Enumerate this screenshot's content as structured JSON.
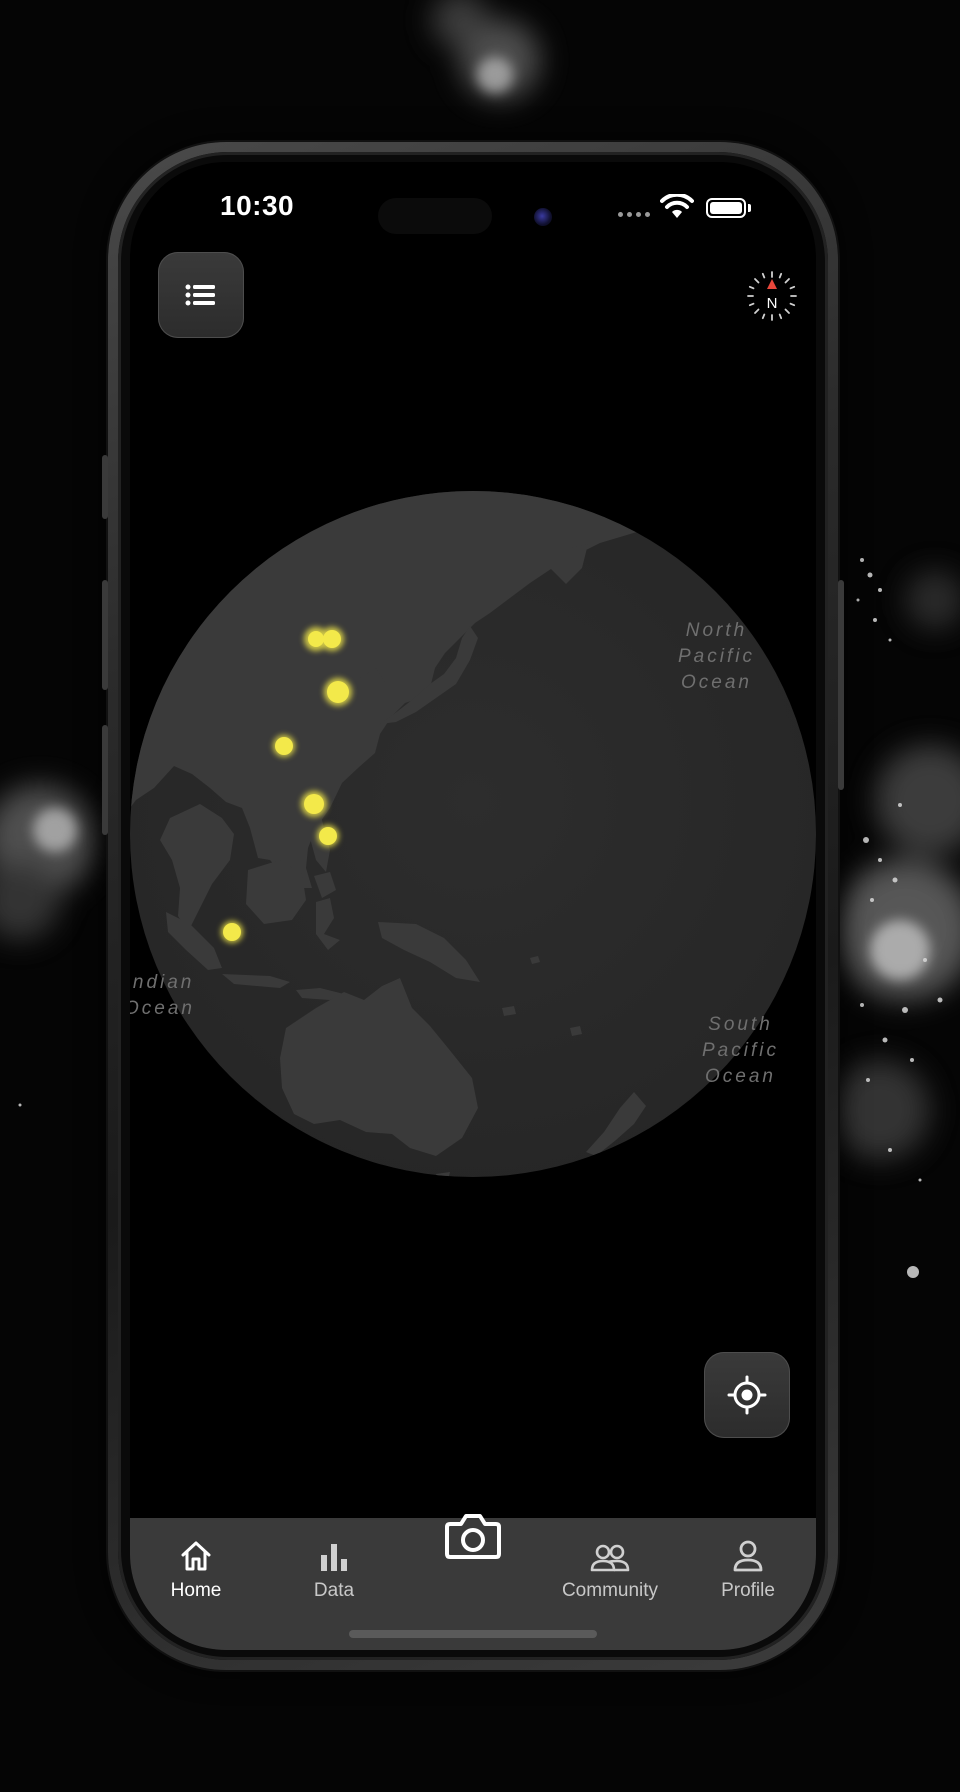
{
  "status_bar": {
    "time": "10:30"
  },
  "map": {
    "ocean_labels": {
      "north_pacific": [
        "North",
        "Pacific",
        "Ocean"
      ],
      "indian": [
        "Indian",
        "Ocean"
      ],
      "south_pacific": [
        "South",
        "Pacific",
        "Ocean"
      ]
    },
    "compass": {
      "label": "N",
      "needle_color": "#e8473b"
    },
    "marker_color": "#f3e94a"
  },
  "tab_bar": {
    "tabs": [
      {
        "label": "Home",
        "icon": "home-icon",
        "active": true
      },
      {
        "label": "Data",
        "icon": "bar-chart-icon",
        "active": false
      },
      {
        "label": "",
        "icon": "camera-icon",
        "active": false
      },
      {
        "label": "Community",
        "icon": "people-icon",
        "active": false
      },
      {
        "label": "Profile",
        "icon": "person-icon",
        "active": false
      }
    ]
  },
  "colors": {
    "background": "#000000",
    "globe": "#2b2b2b",
    "land": "#3b3b3b",
    "button": "#333333",
    "tab_bar": "#3a3a3a"
  }
}
